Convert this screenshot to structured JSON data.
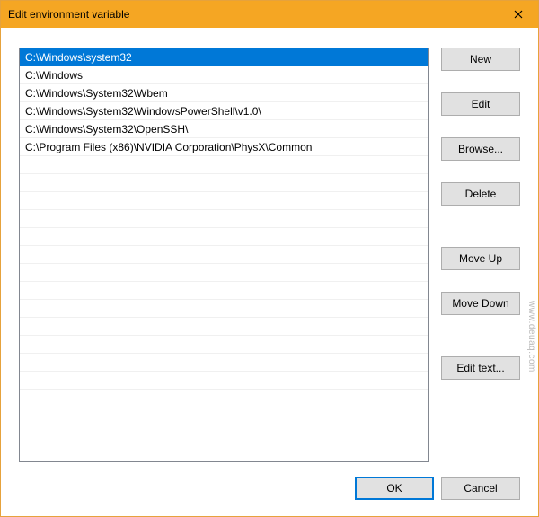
{
  "window": {
    "title": "Edit environment variable"
  },
  "list": {
    "items": [
      "C:\\Windows\\system32",
      "C:\\Windows",
      "C:\\Windows\\System32\\Wbem",
      "C:\\Windows\\System32\\WindowsPowerShell\\v1.0\\",
      "C:\\Windows\\System32\\OpenSSH\\",
      "C:\\Program Files (x86)\\NVIDIA Corporation\\PhysX\\Common"
    ],
    "selected_index": 0,
    "total_rows": 22
  },
  "buttons": {
    "new": "New",
    "edit": "Edit",
    "browse": "Browse...",
    "delete": "Delete",
    "move_up": "Move Up",
    "move_down": "Move Down",
    "edit_text": "Edit text...",
    "ok": "OK",
    "cancel": "Cancel"
  },
  "watermark": "www.deuaq.com"
}
